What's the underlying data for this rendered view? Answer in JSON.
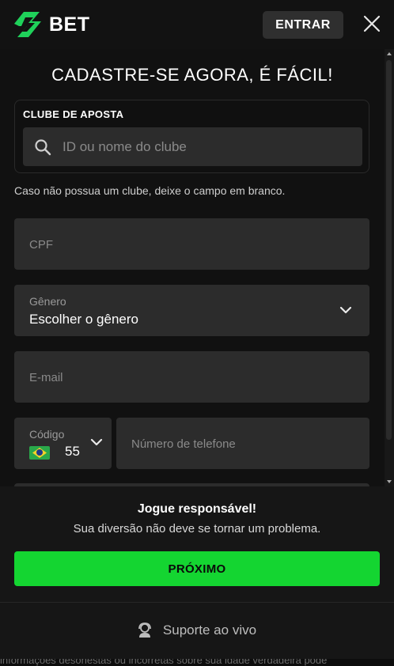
{
  "header": {
    "brand": "BET",
    "login_label": "ENTRAR",
    "close_icon": "close-icon"
  },
  "form": {
    "title": "CADASTRE-SE AGORA, É FÁCIL!",
    "club": {
      "label": "CLUBE DE APOSTA",
      "placeholder": "ID ou nome do clube",
      "hint": "Caso não possua um clube, deixe o campo em branco."
    },
    "cpf_placeholder": "CPF",
    "gender": {
      "label": "Gênero",
      "value": "Escolher o gênero"
    },
    "email_placeholder": "E-mail",
    "phone": {
      "code_label": "Código",
      "code_value": "55",
      "country_flag": "brazil-flag",
      "number_placeholder": "Número de telefone"
    }
  },
  "footer": {
    "responsible_title": "Jogue responsável!",
    "responsible_text": "Sua diversão não deve se tornar um problema.",
    "next_label": "PRÓXIMO",
    "support_label": "Suporte ao vivo"
  },
  "background_text": "informações desonestas ou incorretas sobre sua idade verdadeira pode",
  "colors": {
    "accent": "#14d531",
    "logo_green": "#1fd15a",
    "field_bg": "#2c2c2c",
    "background": "#111111"
  }
}
